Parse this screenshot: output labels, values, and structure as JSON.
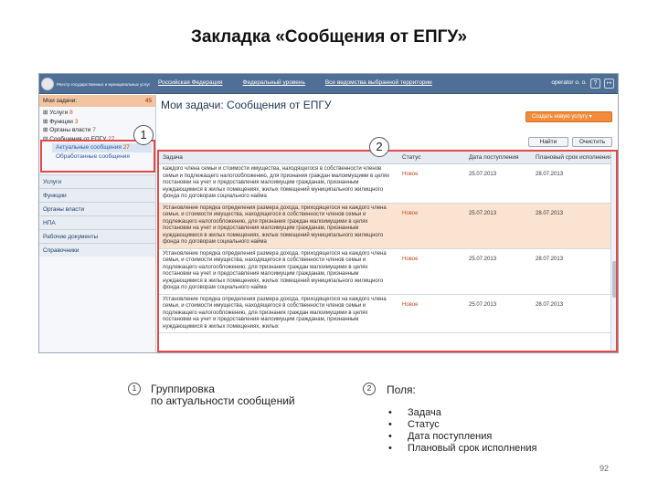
{
  "slide_title": "Закладка «Сообщения от ЕПГУ»",
  "page_number": "92",
  "topbar": {
    "logo_text": "Реестр государственных и муниципальных услуг",
    "nav": [
      "Российская Федерация",
      "Федеральный уровень",
      "Все ведомства выбранной территории"
    ],
    "operator": "operator o. o.",
    "icons": [
      "help-icon",
      "exit-icon"
    ]
  },
  "sidebar": {
    "header_label": "Мои задачи:",
    "header_count": "45",
    "tree": [
      {
        "label": "Услуги",
        "count": "8"
      },
      {
        "label": "Функции",
        "count": "3"
      },
      {
        "label": "Органы власти",
        "count": "7"
      },
      {
        "label": "Сообщения от ЕПГУ",
        "count": "27"
      }
    ],
    "subitems": [
      {
        "label": "Актуальные сообщения",
        "count": "27"
      },
      {
        "label": "Обработанные сообщения",
        "count": ""
      }
    ],
    "sections": [
      "Услуги",
      "Функции",
      "Органы власти",
      "НПА",
      "Рабочие документы",
      "Справочники"
    ]
  },
  "main": {
    "title": "Мои задачи: Сообщения от ЕПГУ",
    "create_button": "Создать новую услугу",
    "find_button": "Найти",
    "clear_button": "Очистить",
    "columns": [
      "Задача",
      "Статус",
      "Дата поступления",
      "Плановый срок исполнения"
    ],
    "rows": [
      {
        "task": "каждого члена семьи и стоимости имущества, находящегося в собственности членов семьи и подлежащего налогообложению, для признания граждан малоимущими в целях постановки на учет и предоставления малоимущим гражданам, признанным нуждающимися в жилых помещениях, жилых помещений муниципального жилищного фонда по договорам социального найма",
        "status": "Новое",
        "date": "25.07.2013",
        "plan": "28.07.2013",
        "highlight": false
      },
      {
        "task": "Установление порядка определения размера дохода, приходящегося на каждого члена семьи, и стоимости имущества, находящегося в собственности членов семьи и подлежащего налогообложению, для признания граждан малоимущими в целях постановки на учет и предоставления малоимущим гражданам, признанным нуждающимися в жилых помещениях, жилых помещений муниципального жилищного фонда по договорам социального найма",
        "status": "Новое",
        "date": "25.07.2013",
        "plan": "28.07.2013",
        "highlight": true
      },
      {
        "task": "Установление порядка определения размера дохода, приходящегося на каждого члена семьи, и стоимости имущества, находящегося в собственности членов семьи и подлежащего налогообложению, для признания граждан малоимущими в целях постановки на учет и предоставления малоимущим гражданам, признанным нуждающимися в жилых помещениях, жилых помещений муниципального жилищного фонда по договорам социального найма",
        "status": "Новое",
        "date": "25.07.2013",
        "plan": "28.07.2013",
        "highlight": false
      },
      {
        "task": "Установление порядка определения размера дохода, приходящегося на каждого члена семьи, и стоимости имущества, находящегося в собственности членов семьи и подлежащего налогообложению, для признания граждан малоимущими в целях постановки на учет и предоставления малоимущим гражданам, признанным нуждающимися в жилых помещениях, жилых",
        "status": "Новое",
        "date": "25.07.2013",
        "plan": "28.07.2013",
        "highlight": false
      }
    ]
  },
  "markers": [
    "1",
    "2"
  ],
  "note1": {
    "marker": "1",
    "line1": "Группировка",
    "line2": "по актуальности сообщений"
  },
  "note2": {
    "marker": "2",
    "label": "Поля:"
  },
  "fields": [
    "Задача",
    "Статус",
    "Дата поступления",
    "Плановый срок исполнения"
  ]
}
